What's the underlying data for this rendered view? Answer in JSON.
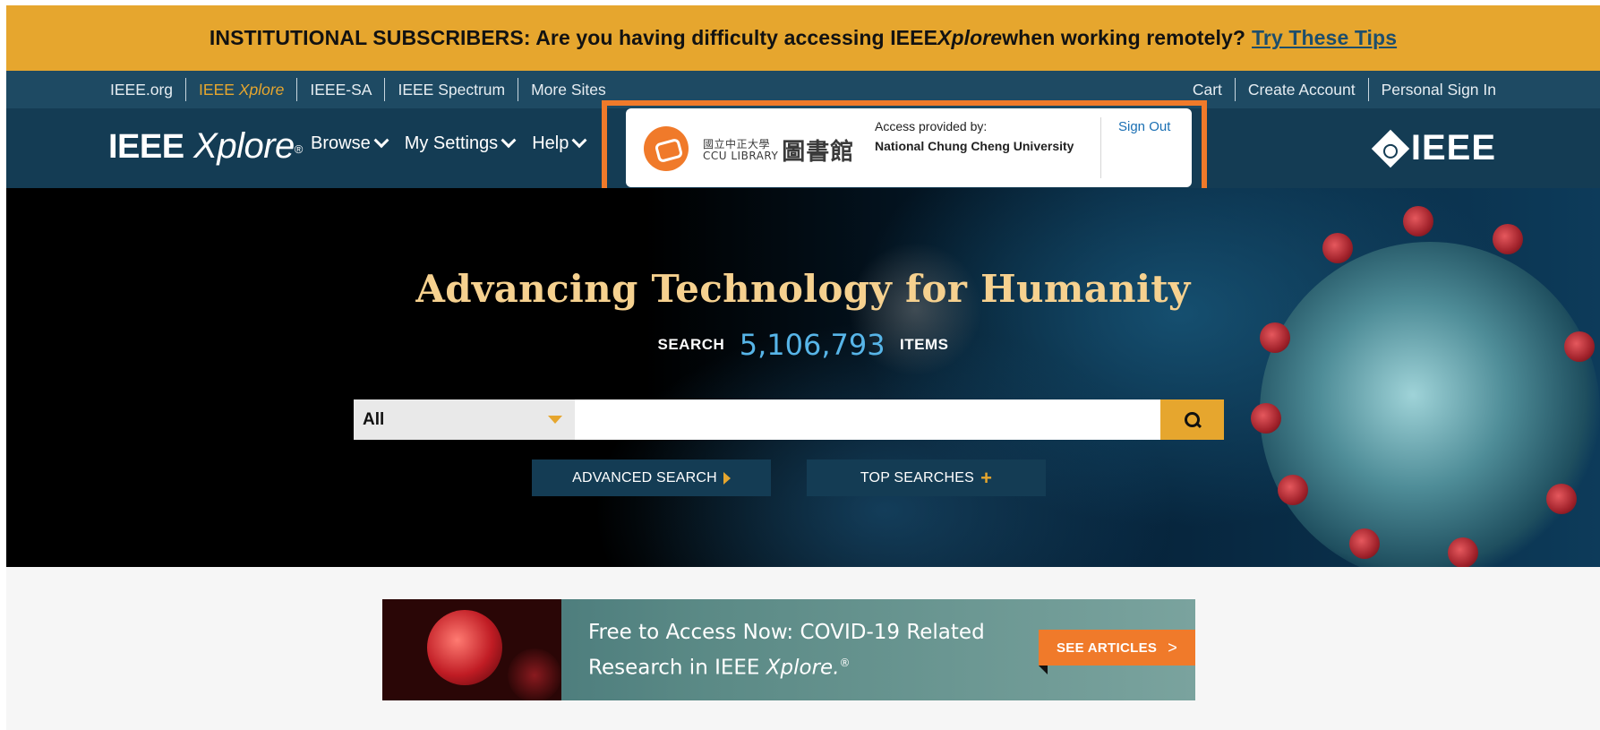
{
  "alert": {
    "text_prefix": "INSTITUTIONAL SUBSCRIBERS: Are you having difficulty accessing IEEE ",
    "text_italic": "Xplore",
    "text_suffix": " when working remotely?",
    "link": "Try These Tips"
  },
  "topnav": {
    "left": [
      "IEEE.org",
      "IEEE ",
      "IEEE-SA",
      "IEEE Spectrum",
      "More Sites"
    ],
    "active_italic": "Xplore",
    "right": [
      "Cart",
      "Create Account",
      "Personal Sign In"
    ]
  },
  "mainnav": {
    "logo_bold": "IEEE",
    "logo_italic": "Xplore",
    "logo_reg": "®",
    "menu": [
      "Browse",
      "My Settings",
      "Help"
    ],
    "brand": "IEEE"
  },
  "access": {
    "library_zh": "國立中正大學",
    "library_en": "CCU LIBRARY",
    "library_big": "圖書館",
    "label": "Access provided by:",
    "institution": "National Chung Cheng University",
    "signout": "Sign Out"
  },
  "hero": {
    "title": "Advancing Technology for Humanity",
    "count_prefix": "SEARCH",
    "count": "5,106,793",
    "count_suffix": "ITEMS",
    "search_scope": "All",
    "search_placeholder": "",
    "advanced": "ADVANCED SEARCH",
    "top": "TOP SEARCHES"
  },
  "banner": {
    "line1": "Free to Access Now: COVID-19 Related",
    "line2_prefix": "Research in IEEE ",
    "line2_italic": "Xplore.",
    "line2_reg": "®",
    "button": "SEE ARTICLES",
    "button_arrow": ">"
  },
  "colors": {
    "alert_bg": "#e6a62e",
    "nav_top": "#1e4a63",
    "nav_main": "#143c54",
    "highlight_box": "#f07a2a",
    "accent_blue": "#57b5e8"
  }
}
